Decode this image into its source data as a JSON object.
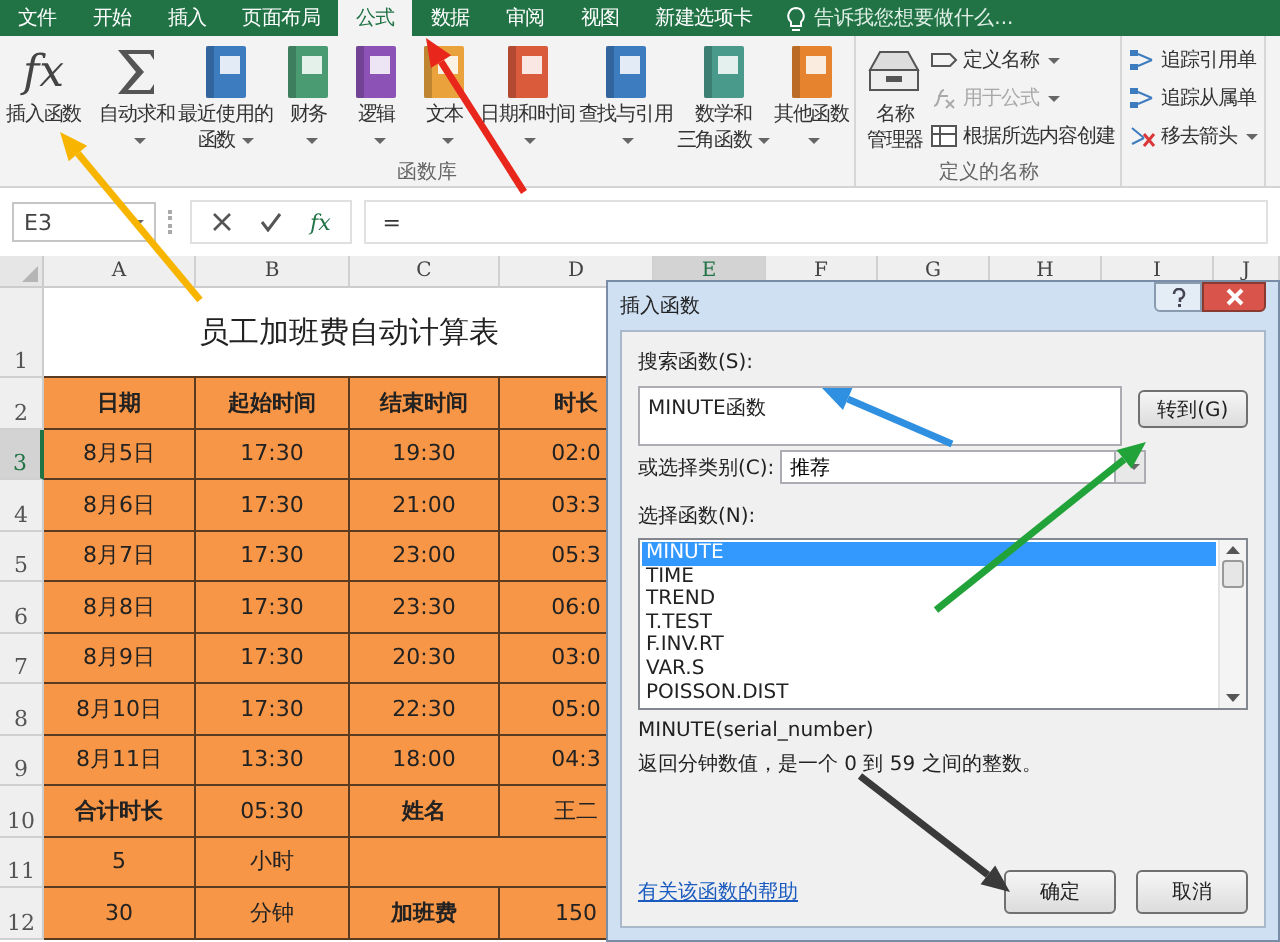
{
  "ribbon": {
    "tabs": [
      {
        "label": "文件",
        "selected": false
      },
      {
        "label": "开始",
        "selected": false
      },
      {
        "label": "插入",
        "selected": false
      },
      {
        "label": "页面布局",
        "selected": false
      },
      {
        "label": "公式",
        "selected": true
      },
      {
        "label": "数据",
        "selected": false
      },
      {
        "label": "审阅",
        "selected": false
      },
      {
        "label": "视图",
        "selected": false
      },
      {
        "label": "新建选项卡",
        "selected": false
      }
    ],
    "tell_me": "告诉我您想要做什么...",
    "groups": [
      {
        "label": "函数库",
        "items": [
          {
            "kind": "fx",
            "icon_text": "fx",
            "label_lines": [
              "插入函数"
            ],
            "dropdown": false
          },
          {
            "kind": "sum",
            "label_lines": [
              "自动求和"
            ],
            "dropdown": true
          },
          {
            "kind": "book",
            "color": "#3e7cc0",
            "label_lines": [
              "最近使用的",
              "函数"
            ],
            "dropdown": true
          },
          {
            "kind": "book",
            "color": "#4a9a72",
            "label_lines": [
              "财务"
            ],
            "dropdown": true
          },
          {
            "kind": "book",
            "color": "#8c52b5",
            "label_lines": [
              "逻辑"
            ],
            "dropdown": true
          },
          {
            "kind": "book",
            "color": "#eaa33c",
            "label_lines": [
              "文本"
            ],
            "dropdown": true
          },
          {
            "kind": "book",
            "color": "#d95b3c",
            "label_lines": [
              "日期和时间"
            ],
            "dropdown": true
          },
          {
            "kind": "book",
            "color": "#3e7cc0",
            "label_lines": [
              "查找与引用"
            ],
            "dropdown": true
          },
          {
            "kind": "book",
            "color": "#4a9a8c",
            "label_lines": [
              "数学和",
              "三角函数"
            ],
            "dropdown": true
          },
          {
            "kind": "book",
            "color": "#e5832f",
            "label_lines": [
              "其他函数"
            ],
            "dropdown": true
          }
        ]
      },
      {
        "label": "定义的名称",
        "items": [
          {
            "kind": "drawer",
            "label_lines": [
              "名称",
              "管理器"
            ],
            "dropdown": false
          },
          {
            "kind": "tag",
            "label": "定义名称",
            "dropdown": true,
            "disabled": false
          },
          {
            "kind": "formula",
            "label": "用于公式",
            "dropdown": true,
            "disabled": true
          },
          {
            "kind": "table",
            "label": "根据所选内容创建",
            "dropdown": false,
            "disabled": false
          }
        ]
      },
      {
        "items": [
          {
            "kind": "trace",
            "label": "追踪引用单",
            "dropdown": false,
            "disabled": false
          },
          {
            "kind": "trace",
            "label": "追踪从属单",
            "dropdown": false,
            "disabled": false
          },
          {
            "kind": "remove",
            "label": "移去箭头",
            "dropdown": true,
            "disabled": false
          }
        ]
      }
    ]
  },
  "formula_bar": {
    "name_box": "E3",
    "fx_label": "fx",
    "formula": "="
  },
  "sheet": {
    "columns": [
      {
        "label": "A",
        "selected": false
      },
      {
        "label": "B",
        "selected": false
      },
      {
        "label": "C",
        "selected": false
      },
      {
        "label": "D",
        "selected": false
      },
      {
        "label": "E",
        "selected": true
      },
      {
        "label": "F",
        "selected": false
      },
      {
        "label": "G",
        "selected": false
      },
      {
        "label": "H",
        "selected": false
      },
      {
        "label": "I",
        "selected": false
      },
      {
        "label": "J",
        "selected": false
      }
    ],
    "rows": [
      {
        "number": "1",
        "selected": false,
        "kind": "title",
        "title": "员工加班费自动计算表"
      },
      {
        "number": "2",
        "selected": false,
        "cells": [
          {
            "kind": "cell",
            "text": "日期",
            "bold": true
          },
          {
            "kind": "cell",
            "text": "起始时间",
            "bold": true
          },
          {
            "kind": "cell",
            "text": "结束时间",
            "bold": true
          },
          {
            "kind": "cell",
            "text": "时长",
            "bold": true
          }
        ]
      },
      {
        "number": "3",
        "selected": true,
        "cells": [
          {
            "kind": "cell",
            "text": "8月5日",
            "bold": false
          },
          {
            "kind": "cell",
            "text": "17:30",
            "bold": false
          },
          {
            "kind": "cell",
            "text": "19:30",
            "bold": false
          },
          {
            "kind": "cell",
            "text": "02:0",
            "bold": false
          }
        ]
      },
      {
        "number": "4",
        "selected": false,
        "cells": [
          {
            "kind": "cell",
            "text": "8月6日",
            "bold": false
          },
          {
            "kind": "cell",
            "text": "17:30",
            "bold": false
          },
          {
            "kind": "cell",
            "text": "21:00",
            "bold": false
          },
          {
            "kind": "cell",
            "text": "03:3",
            "bold": false
          }
        ]
      },
      {
        "number": "5",
        "selected": false,
        "cells": [
          {
            "kind": "cell",
            "text": "8月7日",
            "bold": false
          },
          {
            "kind": "cell",
            "text": "17:30",
            "bold": false
          },
          {
            "kind": "cell",
            "text": "23:00",
            "bold": false
          },
          {
            "kind": "cell",
            "text": "05:3",
            "bold": false
          }
        ]
      },
      {
        "number": "6",
        "selected": false,
        "cells": [
          {
            "kind": "cell",
            "text": "8月8日",
            "bold": false
          },
          {
            "kind": "cell",
            "text": "17:30",
            "bold": false
          },
          {
            "kind": "cell",
            "text": "23:30",
            "bold": false
          },
          {
            "kind": "cell",
            "text": "06:0",
            "bold": false
          }
        ]
      },
      {
        "number": "7",
        "selected": false,
        "cells": [
          {
            "kind": "cell",
            "text": "8月9日",
            "bold": false
          },
          {
            "kind": "cell",
            "text": "17:30",
            "bold": false
          },
          {
            "kind": "cell",
            "text": "20:30",
            "bold": false
          },
          {
            "kind": "cell",
            "text": "03:0",
            "bold": false
          }
        ]
      },
      {
        "number": "8",
        "selected": false,
        "cells": [
          {
            "kind": "cell",
            "text": "8月10日",
            "bold": false
          },
          {
            "kind": "cell",
            "text": "17:30",
            "bold": false
          },
          {
            "kind": "cell",
            "text": "22:30",
            "bold": false
          },
          {
            "kind": "cell",
            "text": "05:0",
            "bold": false
          }
        ]
      },
      {
        "number": "9",
        "selected": false,
        "cells": [
          {
            "kind": "cell",
            "text": "8月11日",
            "bold": false
          },
          {
            "kind": "cell",
            "text": "13:30",
            "bold": false
          },
          {
            "kind": "cell",
            "text": "18:00",
            "bold": false
          },
          {
            "kind": "cell",
            "text": "04:3",
            "bold": false
          }
        ]
      },
      {
        "number": "10",
        "selected": false,
        "cells": [
          {
            "kind": "cell",
            "text": "合计时长",
            "bold": true
          },
          {
            "kind": "cell",
            "text": "05:30",
            "bold": false
          },
          {
            "kind": "cell",
            "text": "姓名",
            "bold": true
          },
          {
            "kind": "cell",
            "text": "王二",
            "bold": false
          }
        ]
      },
      {
        "number": "11",
        "selected": false,
        "cells": [
          {
            "kind": "cell",
            "text": "5",
            "bold": false
          },
          {
            "kind": "cell",
            "text": "小时",
            "bold": false
          },
          {
            "kind": "wide"
          }
        ]
      },
      {
        "number": "12",
        "selected": false,
        "cells": [
          {
            "kind": "cell",
            "text": "30",
            "bold": false
          },
          {
            "kind": "cell",
            "text": "分钟",
            "bold": false
          },
          {
            "kind": "cell",
            "text": "加班费",
            "bold": true
          },
          {
            "kind": "cell",
            "text": "150",
            "bold": false
          }
        ]
      }
    ]
  },
  "dialog": {
    "title": "插入函数",
    "search_label": "搜索函数(S):",
    "search_value": "MINUTE函数",
    "go_button": "转到(G)",
    "category_label": "或选择类别(C):",
    "category_value": "推荐",
    "list_label": "选择函数(N):",
    "functions": [
      {
        "name": "MINUTE",
        "selected": true
      },
      {
        "name": "TIME",
        "selected": false
      },
      {
        "name": "TREND",
        "selected": false
      },
      {
        "name": "T.TEST",
        "selected": false
      },
      {
        "name": "F.INV.RT",
        "selected": false
      },
      {
        "name": "VAR.S",
        "selected": false
      },
      {
        "name": "POISSON.DIST",
        "selected": false
      }
    ],
    "signature": "MINUTE(serial_number)",
    "description": "返回分钟数值，是一个 0 到 59 之间的整数。",
    "help_link": "有关该函数的帮助",
    "buttons": [
      "确定",
      "取消"
    ]
  },
  "annotations": [
    {
      "color": "#f7b500"
    },
    {
      "color": "#e8261c"
    },
    {
      "color": "#2f8fe0"
    },
    {
      "color": "#22a33a"
    },
    {
      "color": "#3a3a3a"
    }
  ]
}
